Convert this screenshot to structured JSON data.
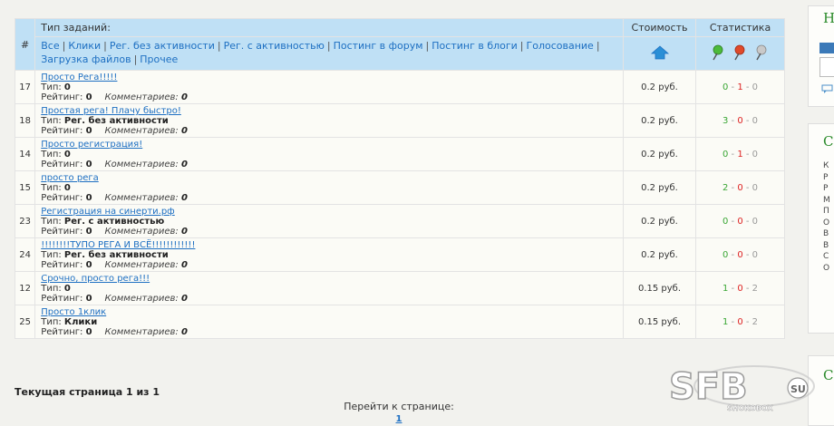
{
  "table": {
    "header": {
      "num": "#",
      "type": "Тип заданий:",
      "cost": "Стоимость",
      "stats": "Статистика"
    },
    "filters": [
      "Все",
      "Клики",
      "Рег. без активности",
      "Рег. с активностью",
      "Постинг в форум",
      "Постинг в блоги",
      "Голосование",
      "Загрузка файлов",
      "Прочее"
    ],
    "labels": {
      "type": "Тип:",
      "rating": "Рейтинг:",
      "comments": "Комментариев:"
    },
    "rows": [
      {
        "num": "17",
        "title": "Просто Рега!!!!!",
        "type": "0",
        "rating": "0",
        "comments": "0",
        "price": "0.2 руб.",
        "s1": "0",
        "s2": "1",
        "s3": "0"
      },
      {
        "num": "18",
        "title": "Простая рега! Плачу быстро!",
        "type": "Рег. без активности",
        "rating": "0",
        "comments": "0",
        "price": "0.2 руб.",
        "s1": "3",
        "s2": "0",
        "s3": "0"
      },
      {
        "num": "14",
        "title": "Просто регистрация!",
        "type": "0",
        "rating": "0",
        "comments": "0",
        "price": "0.2 руб.",
        "s1": "0",
        "s2": "1",
        "s3": "0"
      },
      {
        "num": "15",
        "title": "просто рега",
        "type": "0",
        "rating": "0",
        "comments": "0",
        "price": "0.2 руб.",
        "s1": "2",
        "s2": "0",
        "s3": "0"
      },
      {
        "num": "23",
        "title": "Регистрация на синерти.рф",
        "type": "Рег. с активностью",
        "rating": "0",
        "comments": "0",
        "price": "0.2 руб.",
        "s1": "0",
        "s2": "0",
        "s3": "0"
      },
      {
        "num": "24",
        "title": "!!!!!!!!ТУПО РЕГА И ВСЁ!!!!!!!!!!!!",
        "type": "Рег. без активности",
        "rating": "0",
        "comments": "0",
        "price": "0.2 руб.",
        "s1": "0",
        "s2": "0",
        "s3": "0"
      },
      {
        "num": "12",
        "title": "Срочно, просто рега!!!",
        "type": "0",
        "rating": "0",
        "comments": "0",
        "price": "0.15 руб.",
        "s1": "1",
        "s2": "0",
        "s3": "2"
      },
      {
        "num": "25",
        "title": "Просто 1клик",
        "type": "Клики",
        "rating": "0",
        "comments": "0",
        "price": "0.15 руб.",
        "s1": "1",
        "s2": "0",
        "s3": "2"
      }
    ]
  },
  "footer": {
    "current_page": "Текущая страница 1 из 1",
    "goto": "Перейти к странице:",
    "page_link": "1"
  },
  "sidebar": {
    "h1": "Н",
    "h2": "С",
    "h3": "С",
    "lines": [
      "К",
      "Р",
      "Р",
      "М",
      "П",
      "О",
      "В",
      "В",
      "С",
      "О"
    ]
  },
  "logo": {
    "text": "SFB",
    "suffix": "SU",
    "sub": "SHOKOBOX"
  },
  "colors": {
    "header_bg": "#bfe0f5",
    "link": "#1d6fc2",
    "stat_green": "#39a634",
    "stat_red": "#dd2222"
  },
  "icons": {
    "cost_sort": "home-arrow-icon",
    "stat_green": "green-pin-icon",
    "stat_red": "red-pin-icon",
    "stat_gray": "gray-pin-icon"
  }
}
